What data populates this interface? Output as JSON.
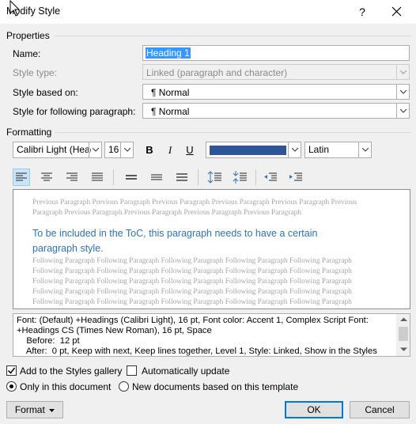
{
  "window": {
    "title": "Modify Style",
    "help_label": "?"
  },
  "properties": {
    "section_label": "Properties",
    "name_label": "Name:",
    "name_value": "Heading 1",
    "style_type_label": "Style type:",
    "style_type_value": "Linked (paragraph and character)",
    "based_on_label": "Style based on:",
    "based_on_value": "¶ Normal",
    "following_label": "Style for following paragraph:",
    "following_value": "¶ Normal"
  },
  "formatting": {
    "section_label": "Formatting",
    "font_value": "Calibri Light (Heac",
    "size_value": "16",
    "bold_label": "B",
    "italic_label": "I",
    "underline_label": "U",
    "font_color": "#2f5597",
    "script_value": "Latin"
  },
  "preview": {
    "previous_lines": [
      "Previous Paragraph Previous Paragraph Previous Paragraph Previous Paragraph Previous Paragraph Previous",
      "Paragraph Previous Paragraph Previous Paragraph Previous Paragraph Previous Paragraph"
    ],
    "sample_lines": [
      "To be included in the ToC, this paragraph needs to have a certain",
      "paragraph style."
    ],
    "following_lines": [
      "Following Paragraph Following Paragraph Following Paragraph Following Paragraph Following Paragraph",
      "Following Paragraph Following Paragraph Following Paragraph Following Paragraph Following Paragraph",
      "Following Paragraph Following Paragraph Following Paragraph Following Paragraph Following Paragraph",
      "Following Paragraph Following Paragraph Following Paragraph Following Paragraph Following Paragraph",
      "Following Paragraph Following Paragraph Following Paragraph Following Paragraph Following Paragraph"
    ]
  },
  "description": {
    "lines": [
      "Font: (Default) +Headings (Calibri Light), 16 pt, Font color: Accent 1, Complex Script Font:",
      "+Headings CS (Times New Roman), 16 pt, Space",
      "    Before:  12 pt",
      "    After:  0 pt, Keep with next, Keep lines together, Level 1, Style: Linked, Show in the Styles"
    ]
  },
  "options": {
    "add_to_gallery_label": "Add to the Styles gallery",
    "add_to_gallery_checked": true,
    "auto_update_label": "Automatically update",
    "auto_update_checked": false,
    "only_this_doc_label": "Only in this document",
    "new_docs_label": "New documents based on this template",
    "selected_scope": "only_this_document"
  },
  "buttons": {
    "format_label": "Format",
    "ok_label": "OK",
    "cancel_label": "Cancel"
  },
  "colors": {
    "selection": "#3399ff",
    "preview_heading": "#2e74b5",
    "default_button_border": "#0078d7"
  }
}
